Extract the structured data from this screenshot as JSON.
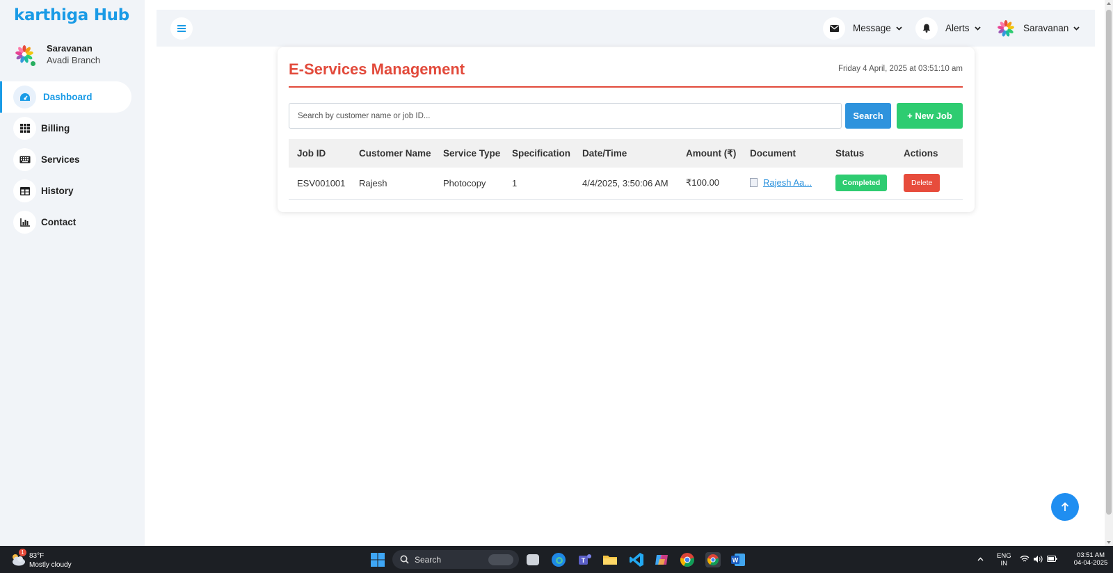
{
  "sidebar": {
    "brand": "karthiga Hub",
    "user": {
      "name": "Saravanan",
      "branch": "Avadi Branch"
    },
    "items": [
      {
        "label": "Dashboard",
        "icon": "dashboard-gauge-icon"
      },
      {
        "label": "Billing",
        "icon": "grid-icon"
      },
      {
        "label": "Services",
        "icon": "keyboard-icon"
      },
      {
        "label": "History",
        "icon": "table-icon"
      },
      {
        "label": "Contact",
        "icon": "bar-chart-icon"
      }
    ]
  },
  "header": {
    "message_label": "Message",
    "alerts_label": "Alerts",
    "user_label": "Saravanan"
  },
  "page": {
    "title": "E-Services Management",
    "datetime": "Friday 4 April, 2025 at 03:51:10 am",
    "search_placeholder": "Search by customer name or job ID...",
    "search_button": "Search",
    "new_job_button": "+ New Job"
  },
  "table": {
    "headers": [
      "Job ID",
      "Customer Name",
      "Service Type",
      "Specification",
      "Date/Time",
      "Amount (₹)",
      "Document",
      "Status",
      "Actions"
    ],
    "rows": [
      {
        "job_id": "ESV001001",
        "customer": "Rajesh",
        "service": "Photocopy",
        "spec": "1",
        "datetime": "4/4/2025, 3:50:06 AM",
        "amount": "₹100.00",
        "document": "Rajesh Aa...",
        "status": "Completed",
        "action": "Delete"
      }
    ]
  },
  "taskbar": {
    "weather_temp": "83°F",
    "weather_desc": "Mostly cloudy",
    "weather_badge": "1",
    "search_label": "Search",
    "lang_top": "ENG",
    "lang_bottom": "IN",
    "time": "03:51 AM",
    "date": "04-04-2025"
  },
  "colors": {
    "accent": "#1a9be6",
    "title_red": "#e24a3b",
    "search_blue": "#2e93dd",
    "success_green": "#2ecc71",
    "delete_red": "#e74c3c"
  }
}
